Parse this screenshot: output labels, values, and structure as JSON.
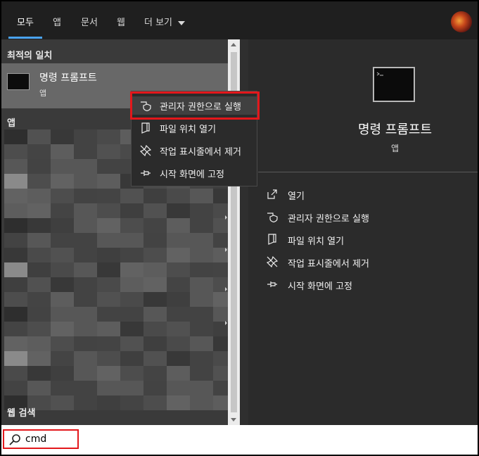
{
  "tabs": [
    {
      "label": "모두",
      "active": true
    },
    {
      "label": "앱"
    },
    {
      "label": "문서"
    },
    {
      "label": "웹"
    },
    {
      "label": "더 보기",
      "icon": "chevron-down-icon"
    }
  ],
  "avatar": {
    "icon": "user-avatar"
  },
  "results": {
    "best_match_header": "최적의 일치",
    "best_match": {
      "title": "명령 프롬프트",
      "subtitle": "앱",
      "icon": "command-prompt-icon"
    },
    "apps_header": "앱",
    "web_search_header": "웹 검색"
  },
  "context_menu": {
    "items": [
      {
        "label": "관리자 권한으로 실행",
        "icon": "admin-shield-icon"
      },
      {
        "label": "파일 위치 열기",
        "icon": "file-location-icon"
      },
      {
        "label": "작업 표시줄에서 제거",
        "icon": "unpin-taskbar-icon"
      },
      {
        "label": "시작 화면에 고정",
        "icon": "pin-start-icon"
      }
    ]
  },
  "preview": {
    "title": "명령 프롬프트",
    "subtitle": "앱",
    "icon": "command-prompt-icon",
    "actions": [
      {
        "label": "열기",
        "icon": "open-icon"
      },
      {
        "label": "관리자 권한으로 실행",
        "icon": "admin-shield-icon"
      },
      {
        "label": "파일 위치 열기",
        "icon": "file-location-icon"
      },
      {
        "label": "작업 표시줄에서 제거",
        "icon": "unpin-taskbar-icon"
      },
      {
        "label": "시작 화면에 고정",
        "icon": "pin-start-icon"
      }
    ]
  },
  "search": {
    "value": "cmd",
    "icon": "search-icon"
  },
  "colors": {
    "accent": "#4aa3f0",
    "highlight": "#e3171b",
    "panel": "#2b2b2b"
  }
}
